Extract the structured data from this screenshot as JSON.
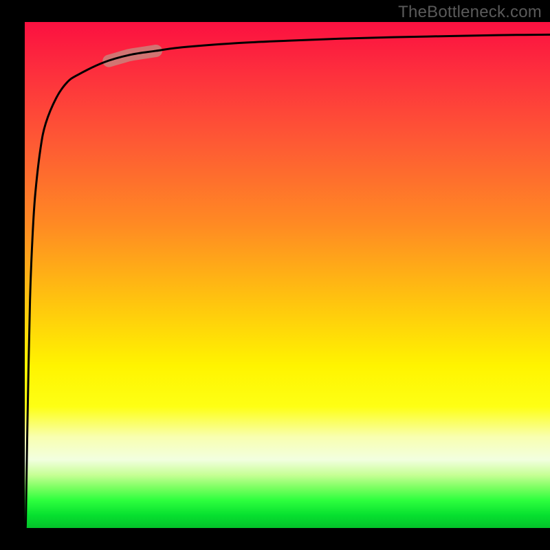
{
  "watermark": "TheBottleneck.com",
  "chart_data": {
    "type": "line",
    "title": "",
    "xlabel": "",
    "ylabel": "",
    "x": [
      0,
      0.2,
      0.5,
      1,
      1.5,
      2,
      3,
      4,
      6,
      8,
      10,
      15,
      20,
      25,
      30,
      40,
      50,
      60,
      70,
      80,
      90,
      100
    ],
    "values": [
      0,
      1,
      20,
      45,
      58,
      66,
      75,
      80,
      85,
      88,
      89.5,
      92,
      93.5,
      94.3,
      95,
      95.8,
      96.3,
      96.7,
      97,
      97.2,
      97.4,
      97.5
    ],
    "xlim": [
      0,
      100
    ],
    "ylim": [
      0,
      100
    ],
    "highlight_segment": {
      "x_start": 16,
      "x_end": 25
    },
    "background_gradient": {
      "top": "#fb1040",
      "mid": "#ffe500",
      "bottom": "#04c12a"
    }
  }
}
